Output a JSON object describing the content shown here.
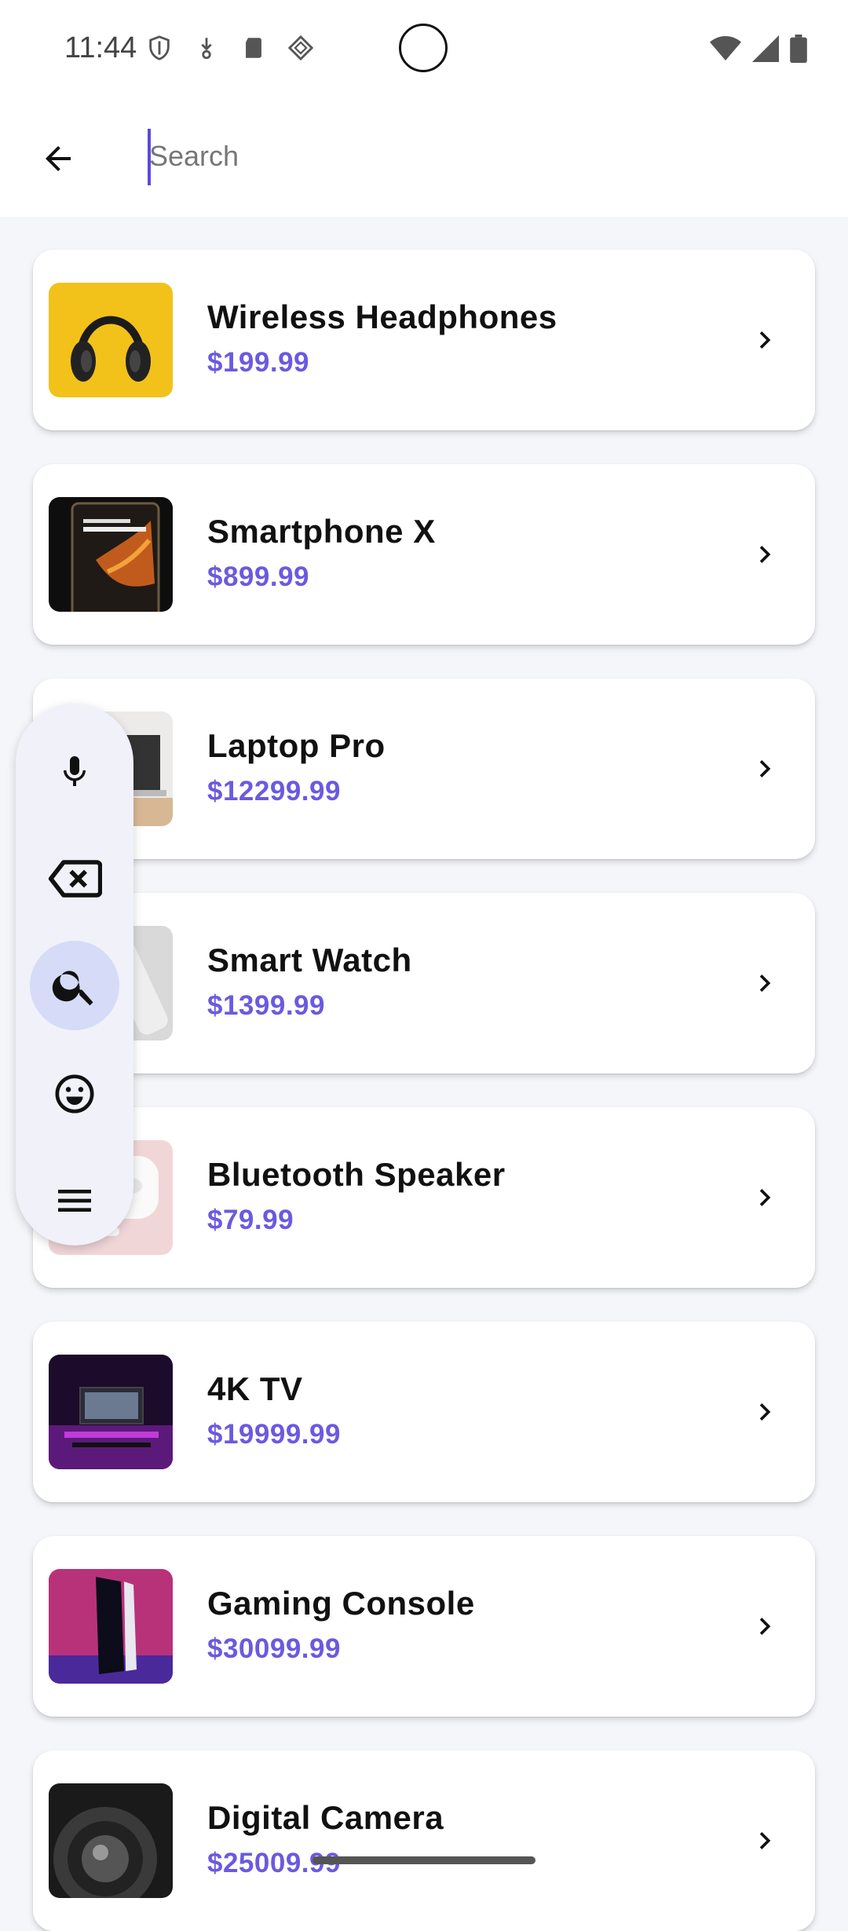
{
  "status_bar": {
    "time": "11:44",
    "left_icons": [
      "shield-icon",
      "download-icon",
      "sd-card-icon",
      "cast-icon"
    ],
    "right_icons": [
      "wifi-icon",
      "signal-icon",
      "battery-icon"
    ]
  },
  "search": {
    "placeholder": "Search",
    "value": ""
  },
  "accent_color": "#6a5ae0",
  "products": [
    {
      "name": "Wireless Headphones",
      "price": "$199.99",
      "image": "headphones"
    },
    {
      "name": "Smartphone X",
      "price": "$899.99",
      "image": "smartphone"
    },
    {
      "name": "Laptop Pro",
      "price": "$12299.99",
      "image": "laptop"
    },
    {
      "name": "Smart Watch",
      "price": "$1399.99",
      "image": "smartwatch"
    },
    {
      "name": "Bluetooth Speaker",
      "price": "$79.99",
      "image": "earbuds"
    },
    {
      "name": "4K TV",
      "price": "$19999.99",
      "image": "tv"
    },
    {
      "name": "Gaming Console",
      "price": "$30099.99",
      "image": "console"
    },
    {
      "name": "Digital Camera",
      "price": "$25009.99",
      "image": "camera-lens"
    }
  ],
  "floating_toolbar": {
    "buttons": [
      "microphone-icon",
      "backspace-icon",
      "search-icon",
      "emoji-icon",
      "menu-icon"
    ],
    "active": "search-icon"
  }
}
